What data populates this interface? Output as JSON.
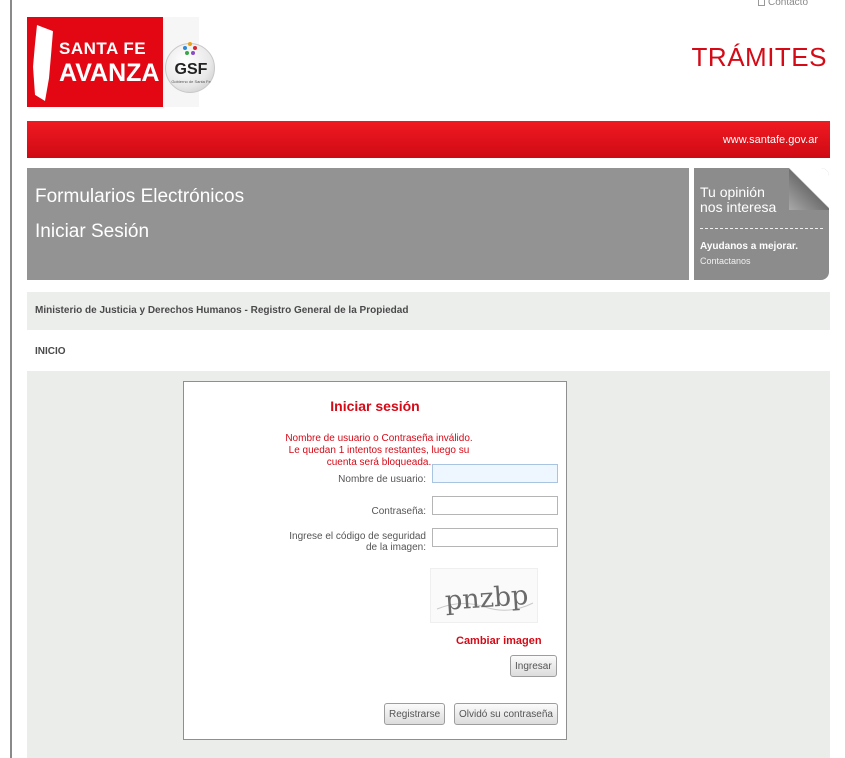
{
  "header": {
    "top_link": "Contacto",
    "logo_line1": "SANTA FE",
    "logo_line2": "AVANZA",
    "seal_text": "GSF",
    "seal_subtext": "Gobierno de Santa Fe",
    "section_title": "TRÁMITES",
    "site_url": "www.santafe.gov.ar"
  },
  "banner": {
    "title": "Formularios Electrónicos",
    "subtitle": "Iniciar Sesión"
  },
  "opinion_box": {
    "line1": "Tu opinión",
    "line2": "nos interesa",
    "cta": "Ayudanos a mejorar.",
    "link": "Contactanos"
  },
  "breadcrumb": {
    "ministry": "Ministerio de Justicia y Derechos Humanos - Registro General de la Propiedad",
    "home": "INICIO"
  },
  "login": {
    "title": "Iniciar sesión",
    "error": "Nombre de usuario o Contraseña inválido. Le quedan 1 intentos restantes, luego su cuenta será bloqueada.",
    "username_label": "Nombre de usuario:",
    "username_value": "",
    "password_label": "Contraseña:",
    "password_value": "",
    "captcha_label_line1": "Ingrese el código de seguridad",
    "captcha_label_line2": "de la imagen:",
    "captcha_value": "",
    "captcha_text": "pnzbp",
    "change_image": "Cambiar imagen",
    "submit": "Ingresar",
    "register": "Registrarse",
    "forgot": "Olvidó su contraseña"
  },
  "colors": {
    "brand_red": "#d40a17",
    "banner_gray": "#939393",
    "panel_bg": "#ebedeb"
  }
}
